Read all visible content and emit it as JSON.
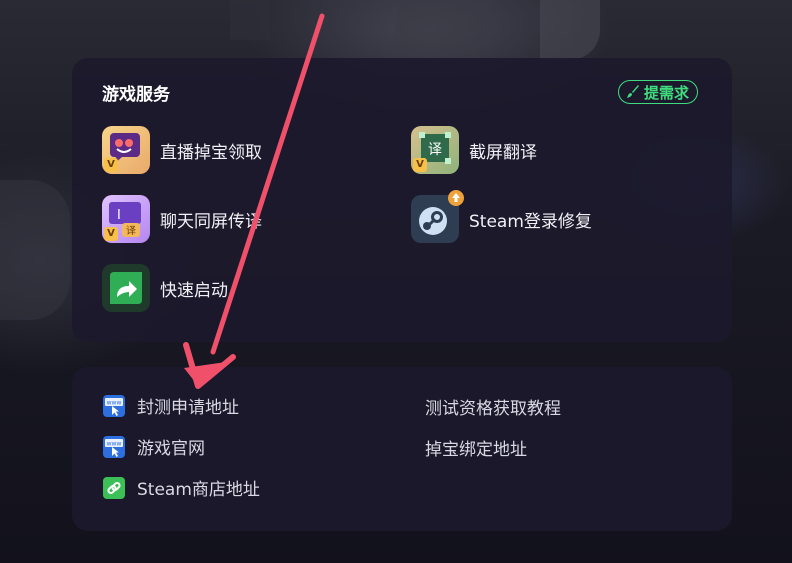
{
  "services": {
    "title": "游戏服务",
    "request_label": "提需求",
    "accent_color": "#3fdc7e",
    "items": [
      {
        "label": "直播掉宝领取",
        "icon": "live-drop-icon",
        "vip": "V"
      },
      {
        "label": "截屏翻译",
        "icon": "screenshot-translate-icon",
        "vip": "V"
      },
      {
        "label": "聊天同屏传译",
        "icon": "chat-translate-icon",
        "vip": "V",
        "sub_glyph": "译",
        "glyph_i": "I"
      },
      {
        "label": "Steam登录修复",
        "icon": "steam-icon"
      },
      {
        "label": "快速启动",
        "icon": "quick-launch-icon"
      }
    ],
    "translate_glyph": "译"
  },
  "links": {
    "www_glyph": "www",
    "items": [
      {
        "label": "封测申请地址",
        "icon": "www-icon"
      },
      {
        "label": "测试资格获取教程"
      },
      {
        "label": "游戏官网",
        "icon": "www-icon"
      },
      {
        "label": "掉宝绑定地址"
      },
      {
        "label": "Steam商店地址",
        "icon": "link-icon"
      }
    ]
  },
  "annotation": {
    "color": "#f0506a"
  }
}
